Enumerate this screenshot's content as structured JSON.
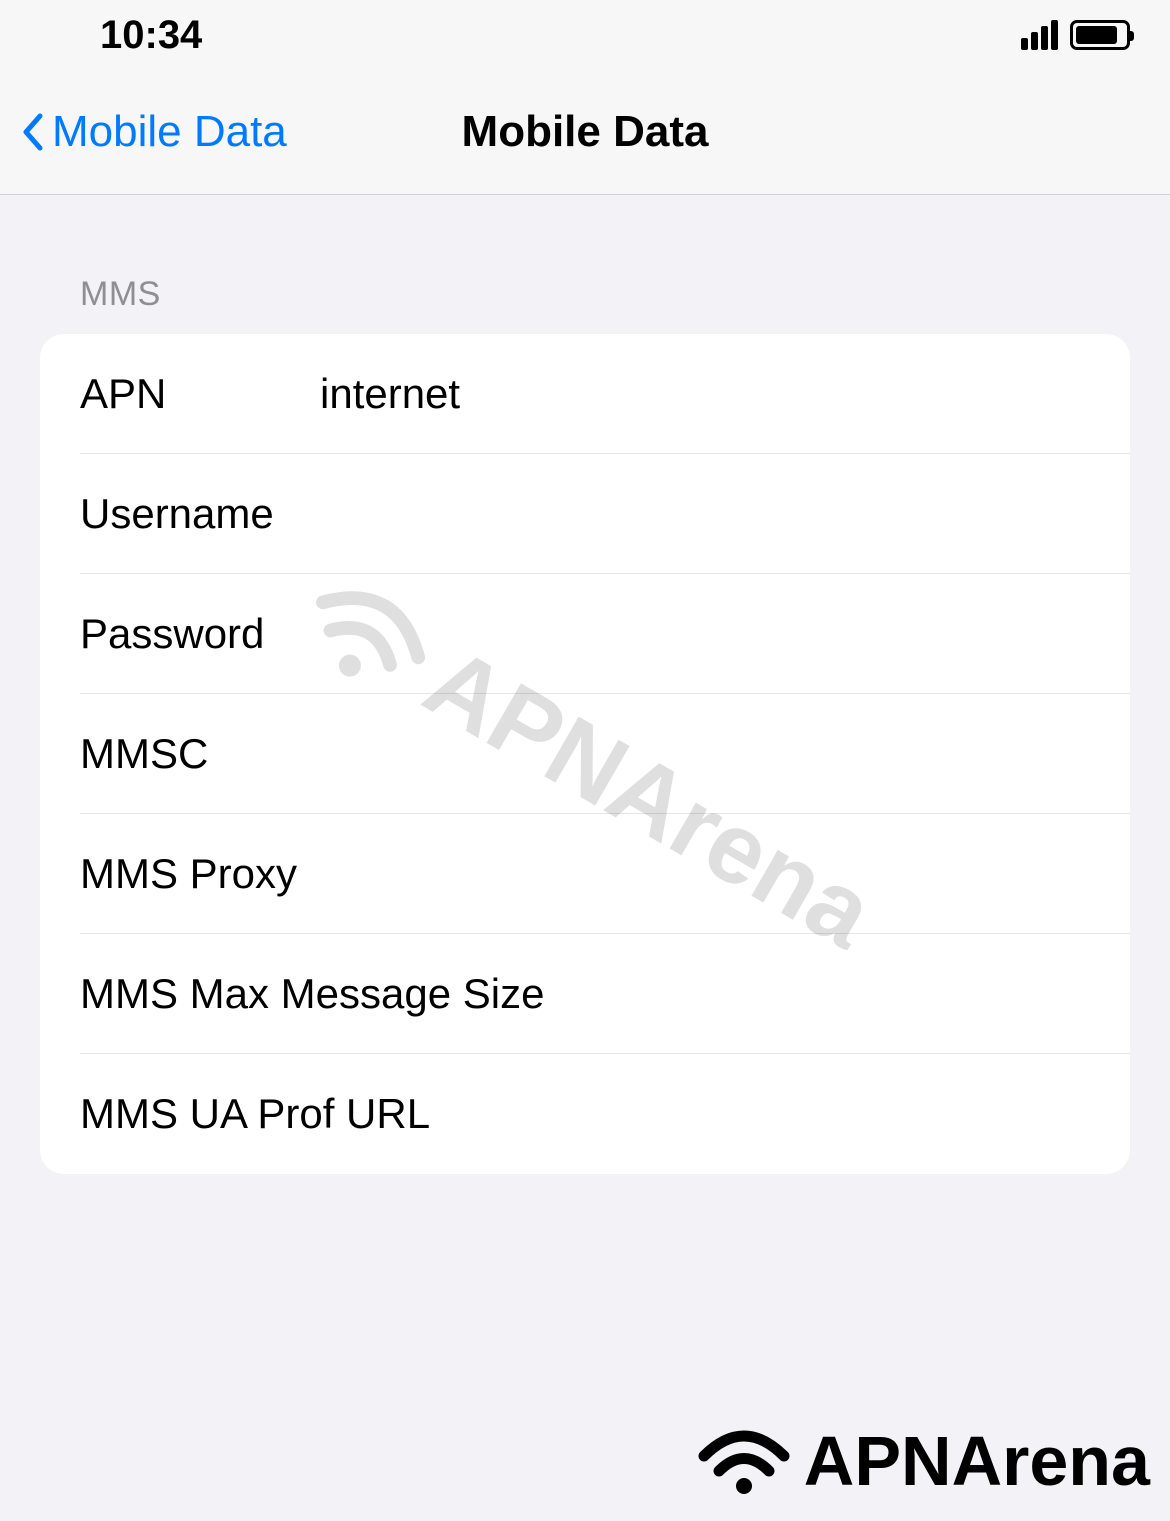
{
  "status_bar": {
    "time": "10:34"
  },
  "nav": {
    "back_label": "Mobile Data",
    "title": "Mobile Data"
  },
  "section": {
    "header": "MMS",
    "fields": {
      "apn": {
        "label": "APN",
        "value": "internet"
      },
      "username": {
        "label": "Username",
        "value": ""
      },
      "password": {
        "label": "Password",
        "value": ""
      },
      "mmsc": {
        "label": "MMSC",
        "value": ""
      },
      "mms_proxy": {
        "label": "MMS Proxy",
        "value": ""
      },
      "mms_max_size": {
        "label": "MMS Max Message Size",
        "value": ""
      },
      "mms_ua_prof": {
        "label": "MMS UA Prof URL",
        "value": ""
      }
    }
  },
  "watermark": {
    "text": "APNArena"
  }
}
